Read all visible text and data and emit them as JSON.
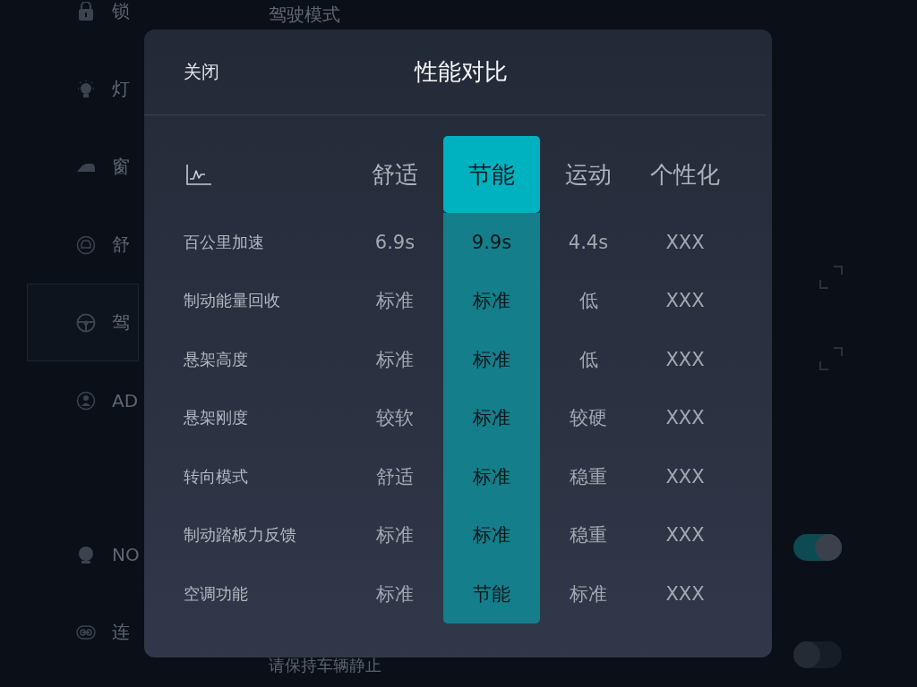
{
  "background": {
    "title": "驾驶模式",
    "sidebar_groups": [
      {
        "items": [
          {
            "label": "锁",
            "selected": false
          },
          {
            "label": "灯",
            "selected": false
          },
          {
            "label": "窗",
            "selected": false
          },
          {
            "label": "舒",
            "selected": false
          },
          {
            "label": "驾",
            "selected": true
          },
          {
            "label": "AD",
            "selected": false
          }
        ]
      },
      {
        "items": [
          {
            "label": "NO",
            "selected": false
          },
          {
            "label": "连",
            "selected": false
          }
        ]
      }
    ],
    "toggles": [
      {
        "on": true
      },
      {
        "on": false
      }
    ],
    "footer_text": "请保持车辆静止"
  },
  "dialog": {
    "close_label": "关闭",
    "title": "性能对比",
    "columns": [
      {
        "label": "舒适",
        "selected": false
      },
      {
        "label": "节能",
        "selected": true
      },
      {
        "label": "运动",
        "selected": false
      },
      {
        "label": "个性化",
        "selected": false
      }
    ],
    "rows": [
      {
        "label": "百公里加速",
        "values": [
          "6.9s",
          "9.9s",
          "4.4s",
          "XXX"
        ]
      },
      {
        "label": "制动能量回收",
        "values": [
          "标准",
          "标准",
          "低",
          "XXX"
        ]
      },
      {
        "label": "悬架高度",
        "values": [
          "标准",
          "标准",
          "低",
          "XXX"
        ]
      },
      {
        "label": "悬架刚度",
        "values": [
          "较软",
          "标准",
          "较硬",
          "XXX"
        ]
      },
      {
        "label": "转向模式",
        "values": [
          "舒适",
          "标准",
          "稳重",
          "XXX"
        ]
      },
      {
        "label": "制动踏板力反馈",
        "values": [
          "标准",
          "标准",
          "稳重",
          "XXX"
        ]
      },
      {
        "label": "空调功能",
        "values": [
          "标准",
          "节能",
          "标准",
          "XXX"
        ]
      }
    ]
  }
}
